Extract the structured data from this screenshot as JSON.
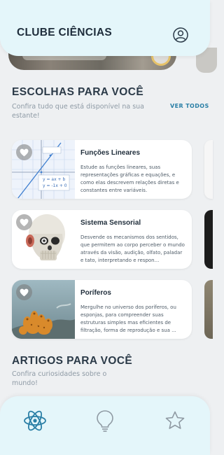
{
  "app": {
    "title": "CLUBE CIÊNCIAS"
  },
  "header": {
    "profile_icon": "user-circle-icon"
  },
  "choices": {
    "title": "ESCOLHAS PARA VOCÊ",
    "subtitle": "Confira tudo que está disponível na sua estante!",
    "see_all": "VER TODOS",
    "cards": [
      {
        "title": "Funções Lineares",
        "description": "Estude as funções lineares, suas representações gráficas e equações, e como elas descrevem relações diretas e constantes entre variáveis.",
        "graph_eq1": "y = ax + b",
        "graph_eq2": "y = -1x + 0"
      },
      {
        "title": "Sistema Sensorial",
        "description": "Desvende os mecanismos dos sentidos, que permitem ao corpo perceber o mundo através da visão, audição, olfato, paladar e tato, interpretando e respon..."
      },
      {
        "title": "Poríferos",
        "description": "Mergulhe no universo dos poríferos, ou esponjas, para compreender suas estruturas simples mas eficientes de filtração, forma de reprodução e sua ..."
      }
    ]
  },
  "articles": {
    "title": "ARTIGOS PARA VOCÊ",
    "subtitle": "Confira curiosidades sobre o mundo!"
  },
  "nav": {
    "items": [
      {
        "icon": "atom-icon",
        "active": true
      },
      {
        "icon": "lightbulb-icon",
        "active": false
      },
      {
        "icon": "star-icon",
        "active": false
      }
    ]
  },
  "colors": {
    "accent": "#2a7fa6",
    "header_bg": "#e4f6fa",
    "page_bg": "#eef0f2"
  }
}
